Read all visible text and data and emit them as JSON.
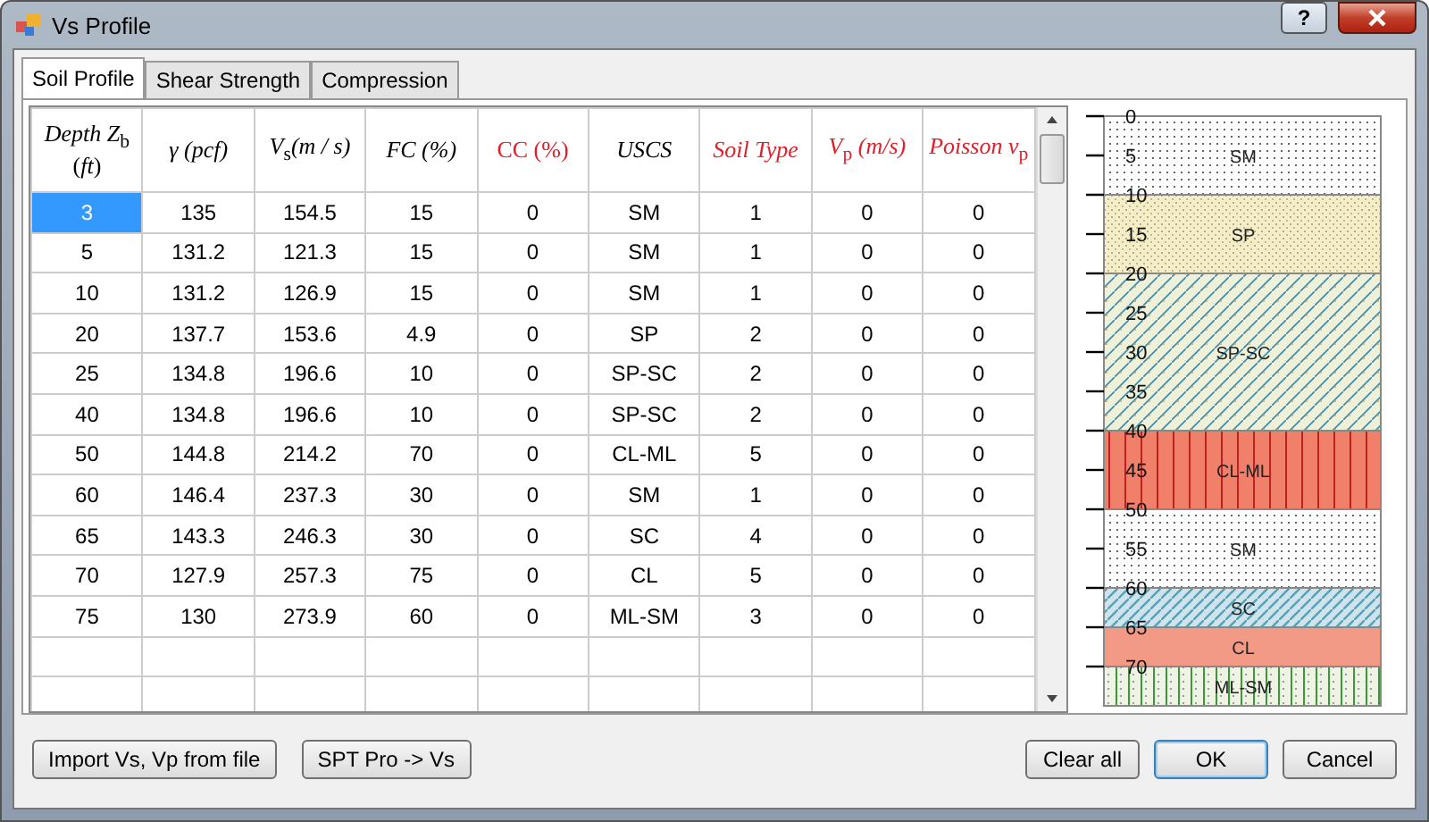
{
  "window": {
    "title": "Vs Profile",
    "help": "?"
  },
  "tabs": [
    {
      "label": "Soil Profile",
      "selected": true
    },
    {
      "label": "Shear Strength",
      "selected": false
    },
    {
      "label": "Compression",
      "selected": false
    }
  ],
  "table": {
    "columns": [
      {
        "label": "*Depth Z*$_{b}$ (*ft*)",
        "color": "#000000"
      },
      {
        "label": "*γ (pcf)*",
        "color": "#000000"
      },
      {
        "label": "*V*$_{s}$*(m / s)*",
        "color": "#000000"
      },
      {
        "label": "*FC (%)*",
        "color": "#000000"
      },
      {
        "label": "CC (%)",
        "color": "#e0202a"
      },
      {
        "label": "*USCS*",
        "color": "#000000"
      },
      {
        "label": "*Soil Type*",
        "color": "#e0202a"
      },
      {
        "label": "*V*$_{p}$ *(m/s)*",
        "color": "#e0202a"
      },
      {
        "label": "*Poisson v*$_{p}$",
        "color": "#e0202a"
      }
    ],
    "rows": [
      {
        "selected": true,
        "cells": [
          "3",
          "135",
          "154.5",
          "15",
          "0",
          "SM",
          "1",
          "0",
          "0"
        ]
      },
      {
        "selected": false,
        "cells": [
          "5",
          "131.2",
          "121.3",
          "15",
          "0",
          "SM",
          "1",
          "0",
          "0"
        ]
      },
      {
        "selected": false,
        "cells": [
          "10",
          "131.2",
          "126.9",
          "15",
          "0",
          "SM",
          "1",
          "0",
          "0"
        ]
      },
      {
        "selected": false,
        "cells": [
          "20",
          "137.7",
          "153.6",
          "4.9",
          "0",
          "SP",
          "2",
          "0",
          "0"
        ]
      },
      {
        "selected": false,
        "cells": [
          "25",
          "134.8",
          "196.6",
          "10",
          "0",
          "SP-SC",
          "2",
          "0",
          "0"
        ]
      },
      {
        "selected": false,
        "cells": [
          "40",
          "134.8",
          "196.6",
          "10",
          "0",
          "SP-SC",
          "2",
          "0",
          "0"
        ]
      },
      {
        "selected": false,
        "cells": [
          "50",
          "144.8",
          "214.2",
          "70",
          "0",
          "CL-ML",
          "5",
          "0",
          "0"
        ]
      },
      {
        "selected": false,
        "cells": [
          "60",
          "146.4",
          "237.3",
          "30",
          "0",
          "SM",
          "1",
          "0",
          "0"
        ]
      },
      {
        "selected": false,
        "cells": [
          "65",
          "143.3",
          "246.3",
          "30",
          "0",
          "SC",
          "4",
          "0",
          "0"
        ]
      },
      {
        "selected": false,
        "cells": [
          "70",
          "127.9",
          "257.3",
          "75",
          "0",
          "CL",
          "5",
          "0",
          "0"
        ]
      },
      {
        "selected": false,
        "cells": [
          "75",
          "130",
          "273.9",
          "60",
          "0",
          "ML-SM",
          "3",
          "0",
          "0"
        ]
      },
      {
        "selected": false,
        "cells": [
          "",
          "",
          "",
          "",
          "",
          "",
          "",
          "",
          ""
        ]
      },
      {
        "selected": false,
        "cells": [
          "",
          "",
          "",
          "",
          "",
          "",
          "",
          "",
          ""
        ]
      }
    ]
  },
  "profile": {
    "ticks": [
      "0",
      "5",
      "10",
      "15",
      "20",
      "25",
      "30",
      "35",
      "40",
      "45",
      "50",
      "55",
      "60",
      "65",
      "70"
    ],
    "layers": [
      {
        "label": "SM",
        "kind": "dots"
      },
      {
        "label": "SP",
        "kind": "sand"
      },
      {
        "label": "SP-SC",
        "kind": "hatch-sand"
      },
      {
        "label": "CL-ML",
        "kind": "lines-red"
      },
      {
        "label": "SM",
        "kind": "dots"
      },
      {
        "label": "SC",
        "kind": "hatch-blue"
      },
      {
        "label": "CL",
        "kind": "plain-red"
      },
      {
        "label": "ML-SM",
        "kind": "lines-green"
      }
    ]
  },
  "buttons_left": [
    {
      "label": "Import Vs, Vp from file",
      "default": false
    },
    {
      "label": "SPT Pro -> Vs",
      "default": false
    }
  ],
  "buttons_right": [
    {
      "label": "Clear all",
      "default": false
    },
    {
      "label": "OK",
      "default": true
    },
    {
      "label": "Cancel",
      "default": false
    }
  ]
}
